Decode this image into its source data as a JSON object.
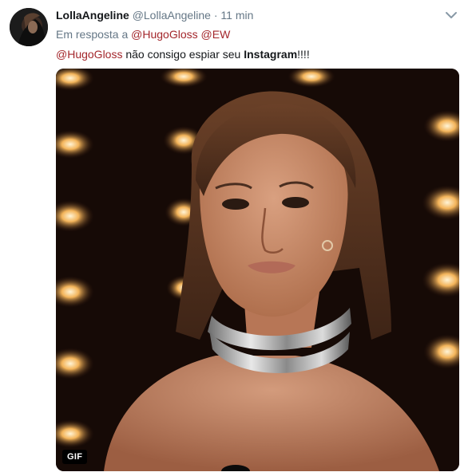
{
  "tweet": {
    "display_name": "LollaAngeline",
    "handle": "@LollaAngeline",
    "separator": "·",
    "time": "11 min",
    "reply_prefix": "Em resposta a",
    "reply_mentions": [
      "@HugoGloss",
      "@EW"
    ],
    "text": {
      "mention": "@HugoGloss",
      "middle": " não consigo espiar seu ",
      "bold": "Instagram",
      "end": "!!!!"
    },
    "media": {
      "badge": "GIF"
    }
  },
  "colors": {
    "mention": "#a3262b",
    "muted": "#657786",
    "text": "#14171a"
  }
}
